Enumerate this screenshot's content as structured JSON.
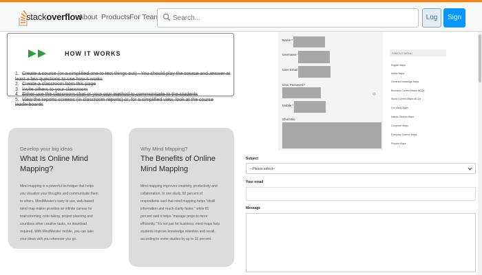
{
  "header": {
    "logo_text_plain": "stack",
    "logo_text_bold": "overflow",
    "nav": [
      "About",
      "Products",
      "For Teams"
    ],
    "search_placeholder": "Search...",
    "login_label": "Log in",
    "signup_label": "Sign up",
    "brand_color": "#f48024",
    "signup_color": "#0a95ff"
  },
  "how_it_works": {
    "title": "HOW IT WORKS",
    "steps": [
      {
        "num": "1.",
        "text": "Create a course (or a simplified one to test things out) - You should play the course and answer at least a few questions to see how it works"
      },
      {
        "num": "2.",
        "text": "Create a classroom from this page"
      },
      {
        "num": "3.",
        "text": "Invite others to your classroom"
      },
      {
        "num": "4.",
        "text": "Either use the classroom chat or your own method to communicate to the students"
      },
      {
        "num": "5.",
        "text": "View the reports screens (in classroom reports) or, for a simplified view, look at the course leaderboards"
      }
    ]
  },
  "card_left": {
    "kicker": "Develop your big ideas",
    "heading_line1": "What Is Online Mind",
    "heading_line2": "Mapping?",
    "para": [
      "Mind mapping is a powerful technique that helps",
      "you visualize your thoughts and communicate them",
      "to others. MindMeister's easy to use, web-based",
      "mind map maker provides an infinite canvas for",
      "brainstorming, note-taking, project planning and",
      "countless other creative tasks, no download",
      "required. With MindMeister mobile, you can take",
      "your ideas with you wherever you go."
    ]
  },
  "card_right": {
    "kicker": "Why Mind Mapping?",
    "heading_line1": "The Benefits of Online",
    "heading_line2": "Mind Mapping",
    "para": [
      "Mind mapping improves creativity, productivity and",
      "collaboration. In one study, 92 percent of",
      "respondents said that mind mapping helps \"distill",
      "information and reach clarity faster,\" while 81",
      "percent said it helps \"manage projects more",
      "efficiently.\" It's not just for business: mind maps help",
      "students improve knowledge retention and recall,",
      "according to some studies by up to 32 percent."
    ]
  },
  "form_shot": {
    "name_label": "Name *",
    "username_label": "Username *",
    "email_label": "User Email *",
    "password_label": "User Password *",
    "mobile_label": "Mobile *",
    "bio_label": "Short Bio"
  },
  "side_panel": {
    "top_text": "Univesidades Google",
    "heading": "FAMOUS MENU",
    "items": [
      "English Maps",
      "Maths Maps",
      "General Knowledge Maps",
      "Business Current Affairs MCQs",
      "World Current Affairs MCQs",
      "Fun study Maps",
      "Islamic Studies Maps",
      "Computer Maps",
      "Everyday Science Maps",
      "Physics Maps"
    ]
  },
  "contact_form": {
    "subject_label": "Subject",
    "subject_value": "--Please select--",
    "email_label": "Your email",
    "message_label": "Message"
  }
}
